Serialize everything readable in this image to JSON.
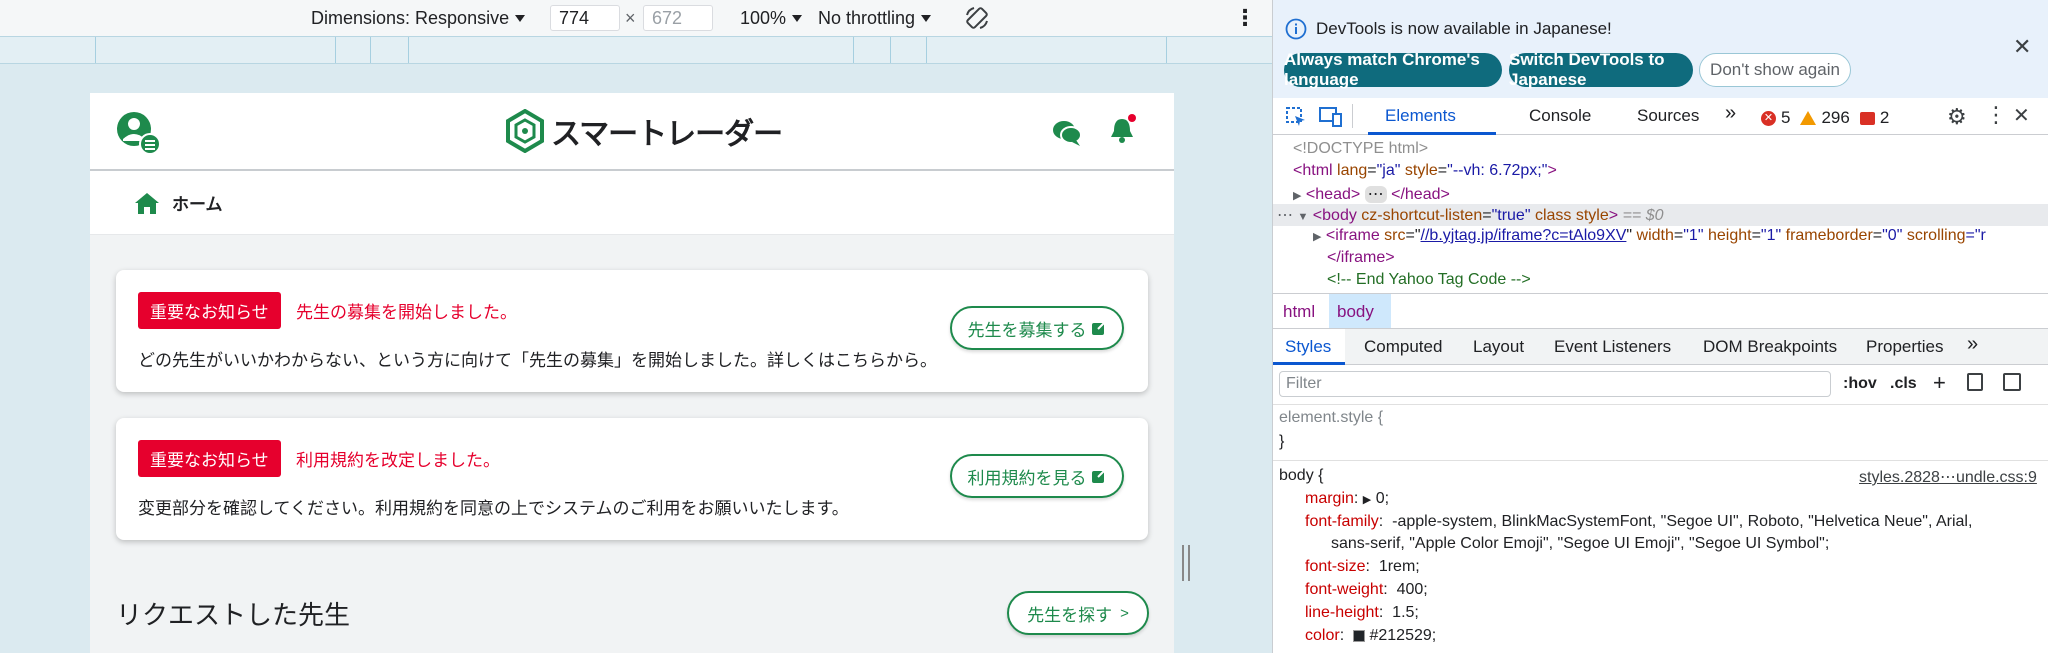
{
  "device_toolbar": {
    "dimensions_label": "Dimensions: Responsive",
    "width_value": "774",
    "times": "×",
    "height_placeholder": "672",
    "zoom": "100%",
    "throttling": "No throttling"
  },
  "site": {
    "logo_text": "スマートレーダー",
    "breadcrumb": "ホーム",
    "notices": [
      {
        "badge": "重要なお知らせ",
        "title": "先生の募集を開始しました。",
        "body": "どの先生がいいかわからない、という方に向けて「先生の募集」を開始しました。詳しくはこちらから。",
        "button": "先生を募集する"
      },
      {
        "badge": "重要なお知らせ",
        "title": "利用規約を改定しました。",
        "body": "変更部分を確認してください。利用規約を同意の上でシステムのご利用をお願いいたします。",
        "button": "利用規約を見る"
      }
    ],
    "section_title": "リクエストした先生",
    "find_button": "先生を探す"
  },
  "devtools": {
    "info_message": "DevTools is now available in Japanese!",
    "btn_match": "Always match Chrome's language",
    "btn_switch": "Switch DevTools to Japanese",
    "btn_dont_show": "Don't show again",
    "tabs": [
      "Elements",
      "Console",
      "Sources"
    ],
    "more_tabs": "»",
    "error_count": "5",
    "warning_count": "296",
    "issue_count": "2",
    "code": {
      "doctype": "<!DOCTYPE html>",
      "html_open_tag": "<html",
      "html_lang_attr": "lang",
      "html_lang_val": "\"ja\"",
      "html_style_attr": "style",
      "html_style_val": "\"--vh: 6.72px;\"",
      "html_close": ">",
      "head": "<head>",
      "head_ellipsis": "⋯",
      "head_close": "</head>",
      "body_open": "<body",
      "body_attr1": "cz-shortcut-listen",
      "body_val1": "\"true\"",
      "body_attr2": "class",
      "body_attr3": "style",
      "body_close": ">",
      "body_eq": "== $0",
      "iframe_open": "<iframe",
      "iframe_src_attr": "src",
      "iframe_src_val": "//b.yjtag.jp/iframe?c=tAlo9XV",
      "iframe_w_attr": "width",
      "iframe_w_val": "\"1\"",
      "iframe_h_attr": "height",
      "iframe_h_val": "\"1\"",
      "iframe_fb_attr": "frameborder",
      "iframe_fb_val": "\"0\"",
      "iframe_scroll_attr": "scrolling",
      "iframe_scroll_val": "=\"r",
      "iframe_close": "</iframe>",
      "comment": "<!-- End Yahoo Tag Code -->"
    },
    "crumbs": [
      "html",
      "body"
    ],
    "subtabs": [
      "Styles",
      "Computed",
      "Layout",
      "Event Listeners",
      "DOM Breakpoints",
      "Properties"
    ],
    "filter_placeholder": "Filter",
    "hov": ":hov",
    "cls": ".cls",
    "element_style": "element.style {",
    "close_brace": "}",
    "body_rule": "body {",
    "source_link": "styles.2828⋯undle.css:9",
    "props": {
      "margin_name": "margin",
      "margin_val": "0;",
      "ff_name": "font-family",
      "ff_val1": "-apple-system, BlinkMacSystemFont, \"Segoe UI\", Roboto, \"Helvetica Neue\", Arial,",
      "ff_val2": "sans-serif, \"Apple Color Emoji\", \"Segoe UI Emoji\", \"Segoe UI Symbol\";",
      "fs_name": "font-size",
      "fs_val": "1rem;",
      "fw_name": "font-weight",
      "fw_val": "400;",
      "lh_name": "line-height",
      "lh_val": "1.5;",
      "color_name": "color",
      "color_val": "#212529;"
    }
  },
  "colors": {
    "brand_green": "#1e8a4c",
    "badge_red": "#e6002d",
    "devtools_blue": "#0b57d0"
  }
}
